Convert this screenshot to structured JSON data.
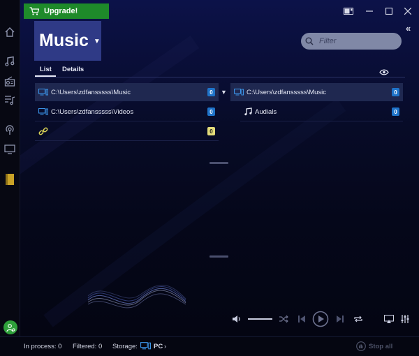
{
  "app": {
    "upgrade_label": "Upgrade!",
    "brand_green": "#1e8a2a",
    "accent_blue": "#1f73c8"
  },
  "header": {
    "title": "Music",
    "filter_placeholder": "Filter"
  },
  "tabs": [
    {
      "label": "List",
      "active": true
    },
    {
      "label": "Details",
      "active": false
    }
  ],
  "sidebar": {
    "items": [
      {
        "icon": "home-icon"
      },
      {
        "icon": "music-note-icon"
      },
      {
        "icon": "radio-icon"
      },
      {
        "icon": "playlist-icon"
      },
      {
        "icon": "podcast-icon"
      },
      {
        "icon": "monitor-icon"
      },
      {
        "icon": "folder-book-icon",
        "active": true
      }
    ]
  },
  "left_list": [
    {
      "icon": "pc-icon",
      "label": "C:\\Users\\zdfansssss\\Music",
      "count": "0",
      "selected": true
    },
    {
      "icon": "pc-icon",
      "label": "C:\\Users\\zdfansssss\\Videos",
      "count": "0",
      "selected": false
    },
    {
      "icon": "link-icon",
      "label": "",
      "count": "0",
      "selected": false
    }
  ],
  "right_list": [
    {
      "icon": "pc-icon",
      "label": "C:\\Users\\zdfansssss\\Music",
      "count": "0",
      "selected": true
    },
    {
      "icon": "music-note-icon",
      "label": "Audials",
      "count": "0",
      "selected": false
    }
  ],
  "status": {
    "in_process": "In process: 0",
    "filtered": "Filtered: 0",
    "storage_label": "Storage:",
    "storage_value": "PC",
    "stop_all": "Stop all"
  }
}
